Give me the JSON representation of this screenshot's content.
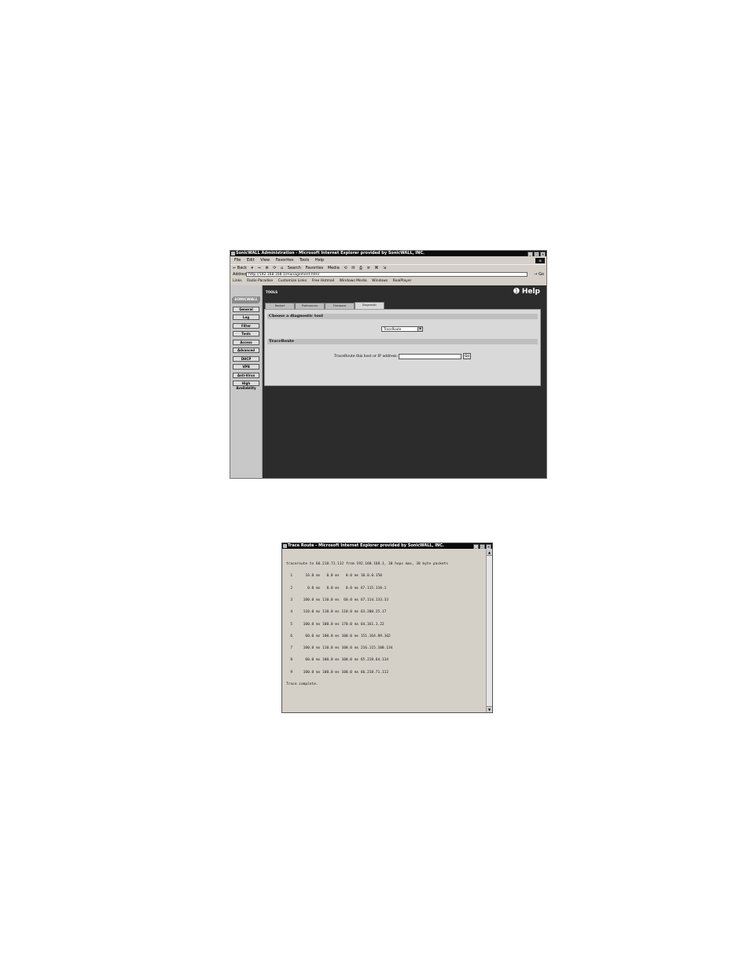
{
  "main_window": {
    "title": "SonicWALL Administration - Microsoft Internet Explorer provided by SonicWALL, INC.",
    "menu": [
      "File",
      "Edit",
      "View",
      "Favorites",
      "Tools",
      "Help"
    ],
    "toolbar": [
      "⇐ Back",
      "▾",
      "⇒",
      "⊗",
      "⟳",
      "⌂",
      "Search",
      "Favorites",
      "Media",
      "⟲",
      "✉",
      "⎙",
      "≡",
      "⌘",
      "⇲"
    ],
    "address_label": "Address",
    "address_value": "http://192.168.168.1/management.html",
    "go_label": "Go",
    "links_label": "Links",
    "links": [
      "Radio Paradise",
      "Customize Links",
      "Free Hotmail",
      "Windows Media",
      "Windows",
      "RealPlayer"
    ],
    "sidebar": {
      "logo": "SONICWALL",
      "items": [
        "General",
        "Log",
        "Filter",
        "Tools",
        "Access",
        "Advanced",
        "DHCP",
        "VPN",
        "Anti-Virus",
        "High Availability"
      ]
    },
    "page": {
      "section_label": "TOOLS",
      "help_label": "Help",
      "tabs": [
        "Restart",
        "Preferences",
        "Firmware",
        "Diagnostic"
      ],
      "active_tab": "Diagnostic",
      "choose_heading": "Choose a diagnostic tool",
      "selected_tool": "TraceRoute",
      "traceroute_heading": "TraceRoute",
      "prompt": "TraceRoute this host or IP address:",
      "host_value": "",
      "go_button": "Go"
    }
  },
  "popup_window": {
    "title": "Trace Route - Microsoft Internet Explorer provided by SonicWALL, INC.",
    "output_lines": [
      "traceroute to 66.218.71.112 from 192.168.168.1, 30 hops max, 38 byte packets",
      "  1      16.0 ms   0.0 ms   0.0 ms 10.0.0.150",
      "  2       0.0 ms   0.0 ms   0.0 ms 67.115.110.1",
      "  3     100.0 ms 110.0 ms  60.0 ms 67.114.133.33",
      "  4     110.0 ms 110.0 ms 110.0 ms 63.200.25.17",
      "  5     100.0 ms 100.0 ms 170.0 ms 64.161.1.22",
      "  6      60.0 ms 100.0 ms 100.0 ms 151.164.89.162",
      "  7     100.0 ms 110.0 ms 100.0 ms 216.115.100.134",
      "  8      60.0 ms 100.0 ms 100.0 ms 65.218.64.134",
      "  9     100.0 ms 100.0 ms 100.0 ms 66.218.71.112",
      "Trace complete."
    ]
  }
}
